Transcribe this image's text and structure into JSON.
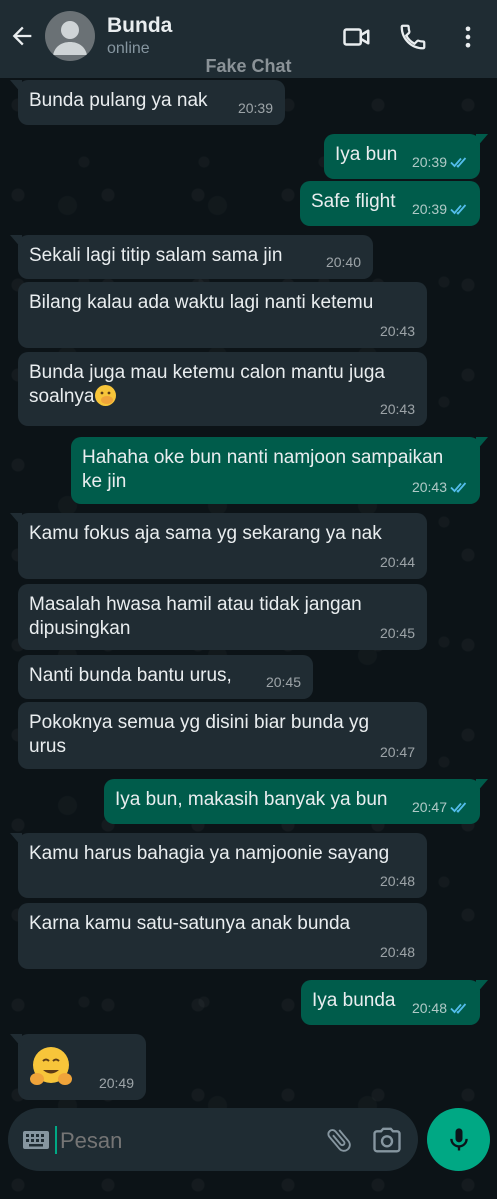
{
  "header": {
    "contact_name": "Bunda",
    "contact_status": "online",
    "watermark": "Fake Chat",
    "icons": [
      "back-arrow-icon",
      "avatar",
      "video-call-icon",
      "phone-icon",
      "more-vert-icon"
    ]
  },
  "messages": [
    {
      "direction": "in",
      "text": "Bunda pulang ya nak",
      "time": "20:39"
    },
    {
      "direction": "out",
      "text": "Iya bun",
      "time": "20:39",
      "status": "read"
    },
    {
      "direction": "out",
      "text": "Safe flight",
      "time": "20:39",
      "status": "read"
    },
    {
      "direction": "in",
      "text": "Sekali lagi titip salam sama jin",
      "time": "20:40"
    },
    {
      "direction": "in",
      "text": "Bilang kalau ada waktu lagi nanti ketemu",
      "time": "20:43"
    },
    {
      "direction": "in",
      "text_line1": "Bunda juga mau ketemu calon mantu juga",
      "text_line2": "soalnya",
      "emoji": "face-with-hand-over-mouth",
      "time": "20:43"
    },
    {
      "direction": "out",
      "text_line1": "Hahaha oke bun nanti namjoon sampaikan",
      "text_line2": "ke jin",
      "time": "20:43",
      "status": "read"
    },
    {
      "direction": "in",
      "text": "Kamu fokus aja sama yg sekarang ya nak",
      "time": "20:44"
    },
    {
      "direction": "in",
      "text_line1": "Masalah hwasa hamil atau tidak jangan",
      "text_line2": "dipusingkan",
      "time": "20:45"
    },
    {
      "direction": "in",
      "text": "Nanti bunda bantu urus,",
      "time": "20:45"
    },
    {
      "direction": "in",
      "text_line1": "Pokoknya semua yg disini biar bunda yg",
      "text_line2": "urus",
      "time": "20:47"
    },
    {
      "direction": "out",
      "text": "Iya bun, makasih banyak ya bun",
      "time": "20:47",
      "status": "read"
    },
    {
      "direction": "in",
      "text": "Kamu harus bahagia ya namjoonie sayang",
      "time": "20:48"
    },
    {
      "direction": "in",
      "text": "Karna kamu satu-satunya anak bunda",
      "time": "20:48"
    },
    {
      "direction": "out",
      "text": "Iya bunda",
      "time": "20:48",
      "status": "read"
    },
    {
      "direction": "in",
      "emoji": "hugging-face",
      "time": "20:49"
    }
  ],
  "composer": {
    "placeholder": "Pesan",
    "icons": [
      "keyboard-icon",
      "attach-icon",
      "camera-icon",
      "mic-icon"
    ]
  },
  "colors": {
    "header_bg": "#1f2c33",
    "incoming_bubble": "#202c33",
    "outgoing_bubble": "#005c4b",
    "read_ticks": "#53bdeb",
    "mic_button": "#00a884"
  }
}
